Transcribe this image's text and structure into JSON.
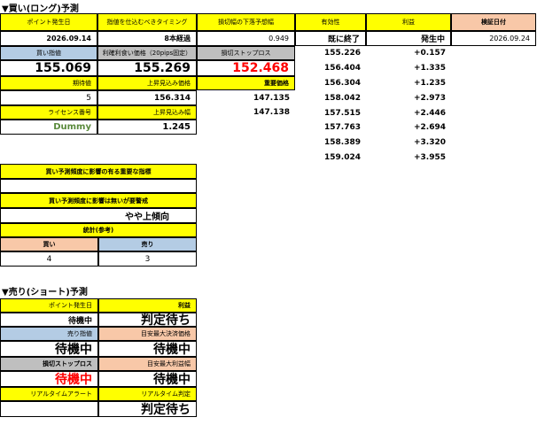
{
  "long": {
    "section_title": "▼買い(ロング)予測",
    "row1": {
      "label_point_date": "ポイント発生日",
      "label_timing": "指値を仕込むべきタイミング",
      "label_stop_lower": "損切幅の下落予想幅",
      "label_valid": "有効性",
      "label_profit": "利益",
      "label_verify_date": "検証日付"
    },
    "row2": {
      "point_date": "2026.09.14",
      "timing": "8本経過",
      "stop_lower": "0.949",
      "valid": "既に終了",
      "profit": "発生中",
      "verify_date": "2026.09.24"
    },
    "row3": {
      "label_buy_limit": "買い指値",
      "label_tp": "利確利食い価格（20pips固定）",
      "label_sl": "損切ストップロス"
    },
    "row4": {
      "buy_limit": "155.069",
      "tp": "155.269",
      "sl": "152.468"
    },
    "row5": {
      "label_expect": "期待値",
      "label_up_expect": "上昇見込み価格",
      "label_key_price": "重要価格"
    },
    "row6": {
      "expect": "5",
      "up_expect": "156.314",
      "key_price": "147.135"
    },
    "row7": {
      "label_license": "ライセンス番号",
      "label_up_width": "上昇見込み幅",
      "key_price2": "147.138"
    },
    "row8": {
      "license": "Dummy",
      "up_width": "1.245"
    },
    "side_prices": [
      "155.226",
      "156.404",
      "156.304",
      "158.042",
      "157.515",
      "157.763",
      "158.389",
      "159.024"
    ],
    "side_profits": [
      "+0.157",
      "+1.335",
      "+1.235",
      "+2.973",
      "+2.446",
      "+2.694",
      "+3.320",
      "+3.955"
    ],
    "box": {
      "q1": "買い予測頻度に影響の有る重要な指標",
      "q1_answer": "",
      "q2": "買い予測頻度に影響は無いが要警戒",
      "q2_answer": "やや上傾向",
      "stats_label": "統計(参考)",
      "buy_label": "買い",
      "sell_label": "売り",
      "buy_count": "4",
      "sell_count": "3"
    }
  },
  "short": {
    "section_title": "▼売り(ショート)予測",
    "label_point_date": "ポイント発生日",
    "label_profit": "利益",
    "point_value": "待機中",
    "profit_value": "判定待ち",
    "label_sell_limit": "売り指値",
    "label_tp_max": "目安最大決済価格",
    "sell_limit_value": "待機中",
    "tp_max_value": "待機中",
    "label_sl": "損切ストップロス",
    "label_tp_width": "目安最大利益幅",
    "sl_value": "待機中",
    "tp_width_value": "待機中",
    "label_alert": "リアルタイムアラート",
    "label_judge": "リアルタイム判定",
    "alert_value": "",
    "judge_value": "判定待ち"
  }
}
